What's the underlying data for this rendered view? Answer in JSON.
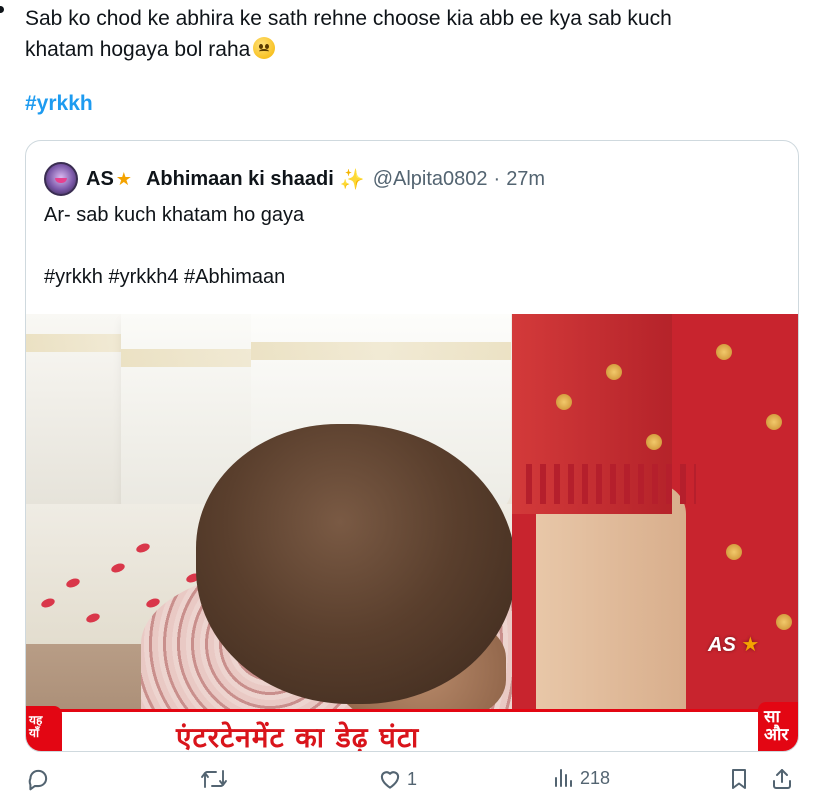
{
  "tweet": {
    "text": "Sab ko chod ke abhira ke sath rehne choose kia abb ee kya sab kuch\nkhatam hogaya bol raha",
    "hashtag": "#yrkkh"
  },
  "quoted_tweet": {
    "display_name": "AS",
    "name_suffix": "Abhimaan ki shaadi",
    "handle": "@Alpita0802",
    "separator": "·",
    "time": "27m",
    "text": "Ar- sab kuch khatam ho gaya",
    "hashtags": "#yrkkh #yrkkh4 #Abhimaan",
    "media": {
      "watermark": "AS",
      "banner_text": "एंटरटेनमेंट का डेढ़ घंटा",
      "logo_left_text": "यह\nयाँ",
      "logo_right_text": "सा\nऔर"
    }
  },
  "actions": {
    "reply_count": "",
    "retweet_count": "",
    "like_count": "1",
    "views_count": "218"
  },
  "icons": {
    "reply": "reply-icon",
    "retweet": "retweet-icon",
    "like": "heart-icon",
    "views": "views-icon",
    "bookmark": "bookmark-icon",
    "share": "share-icon"
  },
  "colors": {
    "link": "#1d9bf0",
    "muted": "#536471",
    "text": "#0f1419",
    "border": "#cfd9de"
  }
}
